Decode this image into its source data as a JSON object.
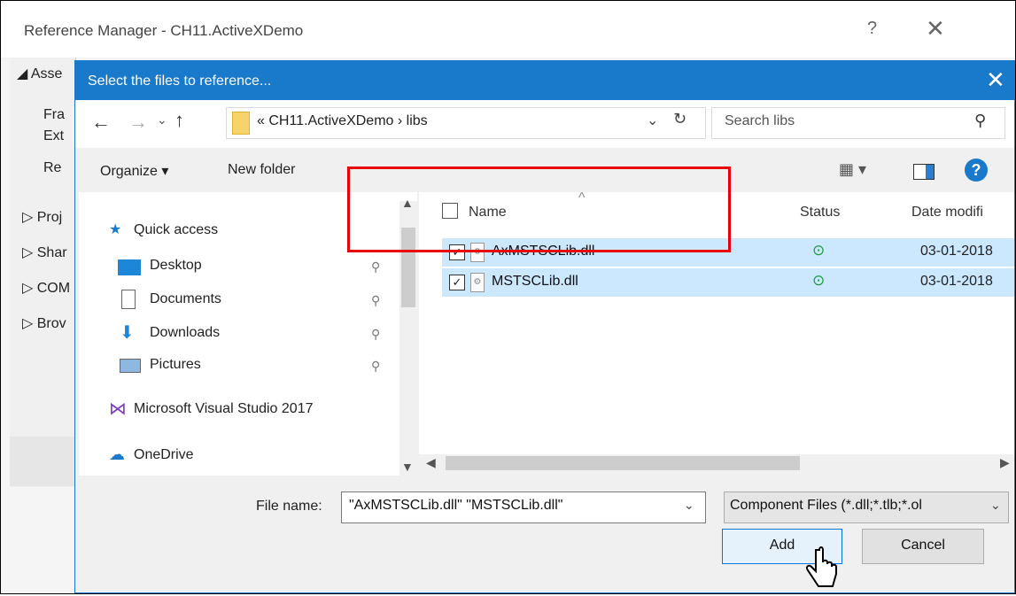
{
  "outer": {
    "title": "Reference Manager - CH11.ActiveXDemo",
    "help": "?",
    "close": "✕",
    "left_items": [
      "◢ Asse",
      "Fra",
      "Ext",
      "Re",
      "▷ Proj",
      "▷ Shar",
      "▷ COM",
      "▷ Brov"
    ]
  },
  "dialog": {
    "title": "Select the files to reference...",
    "close": "✕",
    "nav": {
      "back": "←",
      "forward": "→",
      "recent": "⌄",
      "up": "↑",
      "address": "«  CH11.ActiveXDemo  ›  libs",
      "address_drop": "⌄",
      "refresh": "↻",
      "search_placeholder": "Search libs",
      "search_icon": "⚲"
    },
    "toolbar": {
      "organize": "Organize ▾",
      "new_folder": "New folder",
      "view": "▦ ▾",
      "help": "?"
    },
    "navpane": {
      "items": [
        {
          "icon": "★",
          "label": "Quick access"
        },
        {
          "icon": "",
          "label": "Desktop"
        },
        {
          "icon": "",
          "label": "Documents"
        },
        {
          "icon": "⬇",
          "label": "Downloads"
        },
        {
          "icon": "",
          "label": "Pictures"
        },
        {
          "icon": "⋈",
          "label": "Microsoft Visual Studio 2017"
        },
        {
          "icon": "☁",
          "label": "OneDrive"
        }
      ],
      "pin": "📌"
    },
    "files": {
      "columns": [
        "Name",
        "Status",
        "Date modifi"
      ],
      "sort_arrow": "^",
      "rows": [
        {
          "checked": "✓",
          "name": "AxMSTSCLib.dll",
          "status": "⊙",
          "date": "03-01-2018"
        },
        {
          "checked": "✓",
          "name": "MSTSCLib.dll",
          "status": "⊙",
          "date": "03-01-2018"
        }
      ]
    },
    "bottom": {
      "file_name_label": "File name:",
      "file_name_value": "\"AxMSTSCLib.dll\" \"MSTSCLib.dll\"",
      "file_type": "Component Files (*.dll;*.tlb;*.ol",
      "dropdown_glyph": "⌄",
      "add": "Add",
      "cancel": "Cancel"
    }
  },
  "colors": {
    "title_bar": "#1979ca",
    "selection": "#cce8ff",
    "highlight_box": "#e8000b",
    "status_ok": "#1a9b3c"
  }
}
